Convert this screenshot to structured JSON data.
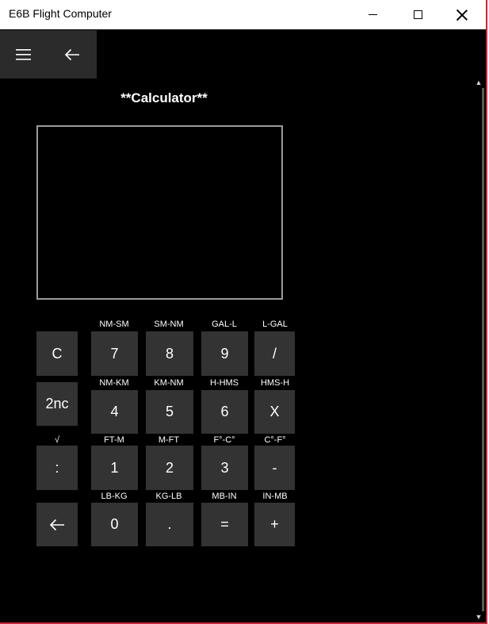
{
  "window": {
    "title": "E6B Flight Computer"
  },
  "page": {
    "title": "**Calculator**",
    "display_value": ""
  },
  "keys": {
    "c": "C",
    "second": "2nc",
    "colon": ":",
    "backspace_icon": "arrow-left-icon",
    "k7": "7",
    "k8": "8",
    "k9": "9",
    "div": "/",
    "k4": "4",
    "k5": "5",
    "k6": "6",
    "mul": "X",
    "k1": "1",
    "k2": "2",
    "k3": "3",
    "sub": "-",
    "k0": "0",
    "dot": ".",
    "eq": "=",
    "add": "+"
  },
  "labels": {
    "row1": [
      "NM-SM",
      "SM-NM",
      "GAL-L",
      "L-GAL"
    ],
    "row2": [
      "NM-KM",
      "KM-NM",
      "H-HMS",
      "HMS-H"
    ],
    "row3": [
      "FT-M",
      "M-FT",
      "F°-C°",
      "C°-F°"
    ],
    "row4": [
      "LB-KG",
      "KG-LB",
      "MB-IN",
      "IN-MB"
    ],
    "sqrt": "√"
  },
  "colors": {
    "background": "#000000",
    "key": "#333333",
    "nav": "#2b2b2b",
    "frame_accent": "#c4283a"
  }
}
